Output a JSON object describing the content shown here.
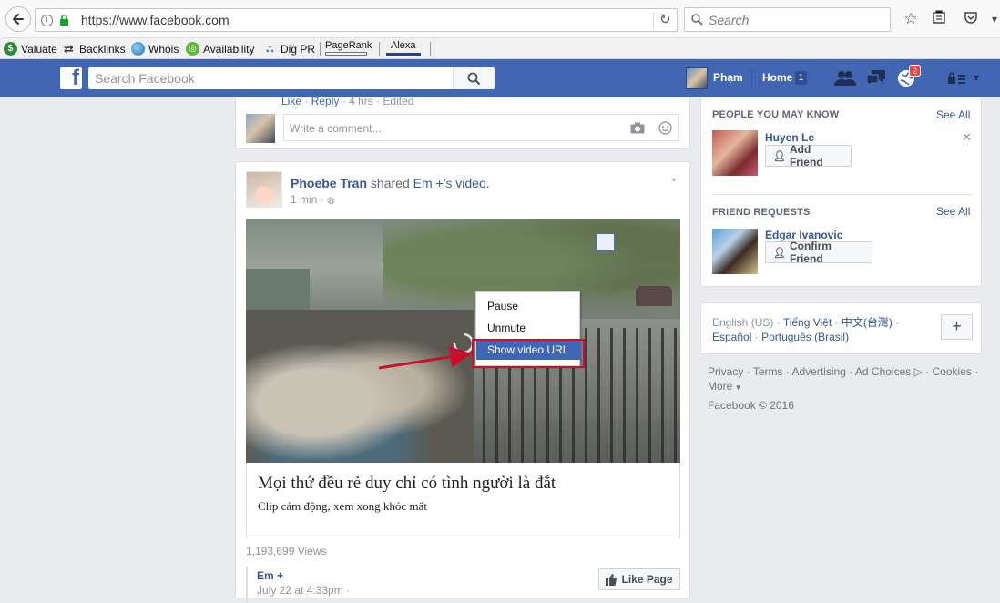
{
  "browser": {
    "url": "https://www.facebook.com",
    "search_placeholder": "Search",
    "bookmarks": [
      "Valuate",
      "Backlinks",
      "Whois",
      "Availability",
      "Dig PR",
      "PageRank",
      "Alexa"
    ]
  },
  "fb_nav": {
    "logo": "f",
    "search_placeholder": "Search Facebook",
    "profile_name": "Phạm",
    "home_label": "Home",
    "home_count": "1",
    "notifications_count": "2"
  },
  "top_comment": {
    "like": "Like",
    "reply": "Reply",
    "meta": "· 4 hrs · Edited",
    "input_placeholder": "Write a comment..."
  },
  "post": {
    "author": "Phoebe Tran",
    "shared_text": "shared",
    "shared_from": "Em +",
    "shared_suffix": "'s",
    "video_word": "video",
    "period": ".",
    "time": "1 min ·",
    "caption_title": "Mọi thứ đều rẻ duy chỉ có tình người là đắt",
    "caption_sub": "Clip cảm động, xem xong khóc mất",
    "views": "1,193,699 Views",
    "page_name": "Em +",
    "page_time": "July 22 at 4:33pm ·",
    "like_page": "Like Page"
  },
  "context_menu": {
    "pause": "Pause",
    "unmute": "Unmute",
    "show_url": "Show video URL"
  },
  "sidebar": {
    "pymk_heading": "PEOPLE YOU MAY KNOW",
    "pymk_see_all": "See All",
    "pymk_name": "Huyen Le",
    "add_friend": "Add Friend",
    "fr_heading": "FRIEND REQUESTS",
    "fr_see_all": "See All",
    "fr_name": "Edgar Ivanovic",
    "confirm_friend": "Confirm Friend"
  },
  "languages": {
    "current": "English (US) ·",
    "lang1": "Tiếng Việt",
    "lang2": "中文(台灣)",
    "lang3": "Español",
    "lang4": "Português (Brasil)",
    "sep": "·",
    "plus": "+"
  },
  "footer": {
    "privacy": "Privacy",
    "terms": "Terms",
    "advertising": "Advertising",
    "ad_choices": "Ad Choices",
    "cookies": "Cookies",
    "more": "More",
    "sep": "·",
    "copyright": "Facebook © 2016"
  }
}
